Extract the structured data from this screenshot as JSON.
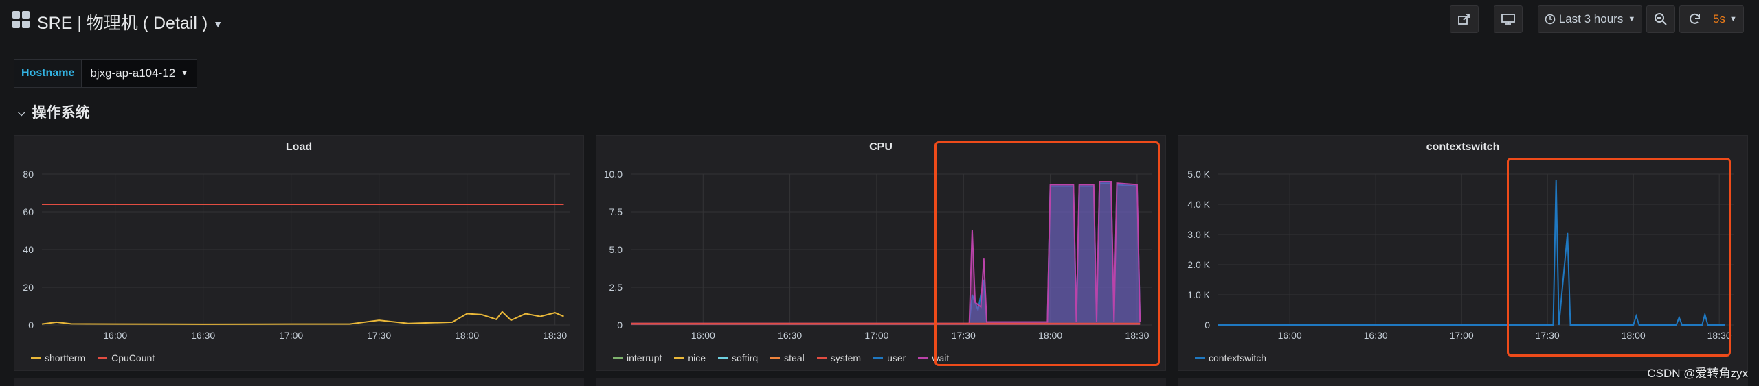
{
  "dashboard": {
    "title": "SRE | 物理机 ( Detail )"
  },
  "toolbar": {
    "time_range": "Last 3 hours",
    "refresh_interval": "5s"
  },
  "variables": [
    {
      "label": "Hostname",
      "value": "bjxg-ap-a104-12"
    }
  ],
  "row": {
    "title": "操作系统"
  },
  "colors": {
    "highlight": "#ee4b1a",
    "var_label": "#33b5e5"
  },
  "panels": [
    {
      "title": "Load",
      "legend": [
        {
          "name": "shortterm",
          "color": "#eab839"
        },
        {
          "name": "CpuCount",
          "color": "#e24d42"
        }
      ]
    },
    {
      "title": "CPU",
      "legend": [
        {
          "name": "interrupt",
          "color": "#7eb26d"
        },
        {
          "name": "nice",
          "color": "#eab839"
        },
        {
          "name": "softirq",
          "color": "#6ed0e0"
        },
        {
          "name": "steal",
          "color": "#ef843c"
        },
        {
          "name": "system",
          "color": "#e24d42"
        },
        {
          "name": "user",
          "color": "#1f78c1"
        },
        {
          "name": "wait",
          "color": "#ba43a9"
        }
      ]
    },
    {
      "title": "contextswitch",
      "legend": [
        {
          "name": "contextswitch",
          "color": "#1f78c1"
        }
      ]
    }
  ],
  "chart_data": [
    {
      "type": "line",
      "title": "Load",
      "x_ticks": [
        "16:00",
        "16:30",
        "17:00",
        "17:30",
        "18:00",
        "18:30"
      ],
      "y_ticks": [
        "0",
        "20",
        "40",
        "60",
        "80"
      ],
      "ylim": [
        0,
        80
      ],
      "xlim": [
        "15:35",
        "18:35"
      ],
      "series": [
        {
          "name": "shortterm",
          "color": "#eab839",
          "points": [
            [
              "15:35",
              0.5
            ],
            [
              "15:40",
              1.5
            ],
            [
              "15:45",
              0.6
            ],
            [
              "16:00",
              0.5
            ],
            [
              "16:30",
              0.4
            ],
            [
              "17:00",
              0.5
            ],
            [
              "17:20",
              0.5
            ],
            [
              "17:30",
              2.5
            ],
            [
              "17:40",
              0.8
            ],
            [
              "17:55",
              1.5
            ],
            [
              "18:00",
              6
            ],
            [
              "18:05",
              5.5
            ],
            [
              "18:10",
              3
            ],
            [
              "18:12",
              7
            ],
            [
              "18:15",
              2.5
            ],
            [
              "18:20",
              6
            ],
            [
              "18:25",
              4.5
            ],
            [
              "18:30",
              6.5
            ],
            [
              "18:33",
              4.5
            ]
          ]
        },
        {
          "name": "CpuCount",
          "color": "#e24d42",
          "points": [
            [
              "15:35",
              64
            ],
            [
              "18:33",
              64
            ]
          ]
        }
      ],
      "legend_position": "bottom-left"
    },
    {
      "type": "area",
      "title": "CPU",
      "x_ticks": [
        "16:00",
        "16:30",
        "17:00",
        "17:30",
        "18:00",
        "18:30"
      ],
      "y_ticks": [
        "0",
        "2.5",
        "5.0",
        "7.5",
        "10.0"
      ],
      "ylim": [
        0,
        10
      ],
      "xlim": [
        "15:35",
        "18:35"
      ],
      "series": [
        {
          "name": "user",
          "color": "#1f78c1",
          "points": [
            [
              "15:35",
              0.1
            ],
            [
              "17:32",
              0.1
            ],
            [
              "17:33",
              2
            ],
            [
              "17:35",
              1
            ],
            [
              "17:37",
              3
            ],
            [
              "17:38",
              0.2
            ],
            [
              "17:59",
              0.2
            ],
            [
              "18:00",
              9.2
            ],
            [
              "18:08",
              9.2
            ],
            [
              "18:09",
              0.2
            ],
            [
              "18:10",
              9.2
            ],
            [
              "18:15",
              9.2
            ],
            [
              "18:16",
              0.2
            ],
            [
              "18:17",
              9.4
            ],
            [
              "18:21",
              9.4
            ],
            [
              "18:22",
              0.2
            ],
            [
              "18:23",
              9.3
            ],
            [
              "18:30",
              9.2
            ],
            [
              "18:31",
              0.2
            ]
          ]
        },
        {
          "name": "wait",
          "color": "#ba43a9",
          "points": [
            [
              "15:35",
              0.1
            ],
            [
              "17:32",
              0.1
            ],
            [
              "17:33",
              6.3
            ],
            [
              "17:34",
              1.5
            ],
            [
              "17:36",
              1.2
            ],
            [
              "17:37",
              4.4
            ],
            [
              "17:38",
              0.2
            ],
            [
              "17:59",
              0.2
            ],
            [
              "18:00",
              9.3
            ],
            [
              "18:08",
              9.3
            ],
            [
              "18:09",
              0.2
            ],
            [
              "18:10",
              9.3
            ],
            [
              "18:15",
              9.3
            ],
            [
              "18:16",
              0.2
            ],
            [
              "18:17",
              9.5
            ],
            [
              "18:21",
              9.5
            ],
            [
              "18:22",
              0.2
            ],
            [
              "18:23",
              9.4
            ],
            [
              "18:30",
              9.3
            ],
            [
              "18:31",
              0.2
            ]
          ]
        },
        {
          "name": "system",
          "color": "#e24d42",
          "points": [
            [
              "15:35",
              0.1
            ],
            [
              "18:31",
              0.1
            ]
          ]
        }
      ],
      "legend_position": "bottom-left"
    },
    {
      "type": "line",
      "title": "contextswitch",
      "x_ticks": [
        "16:00",
        "16:30",
        "17:00",
        "17:30",
        "18:00",
        "18:30"
      ],
      "y_ticks": [
        "0",
        "1.0 K",
        "2.0 K",
        "3.0 K",
        "4.0 K",
        "5.0 K"
      ],
      "ylim": [
        0,
        5000
      ],
      "xlim": [
        "15:35",
        "18:35"
      ],
      "series": [
        {
          "name": "contextswitch",
          "color": "#1f78c1",
          "points": [
            [
              "15:35",
              0
            ],
            [
              "17:32",
              0
            ],
            [
              "17:33",
              4800
            ],
            [
              "17:34",
              0
            ],
            [
              "17:37",
              3050
            ],
            [
              "17:38",
              0
            ],
            [
              "18:00",
              0
            ],
            [
              "18:01",
              300
            ],
            [
              "18:02",
              0
            ],
            [
              "18:15",
              0
            ],
            [
              "18:16",
              250
            ],
            [
              "18:17",
              0
            ],
            [
              "18:24",
              0
            ],
            [
              "18:25",
              350
            ],
            [
              "18:26",
              0
            ],
            [
              "18:32",
              0
            ]
          ]
        }
      ],
      "legend_position": "bottom-left"
    }
  ],
  "watermark": "CSDN @爱转角zyx"
}
